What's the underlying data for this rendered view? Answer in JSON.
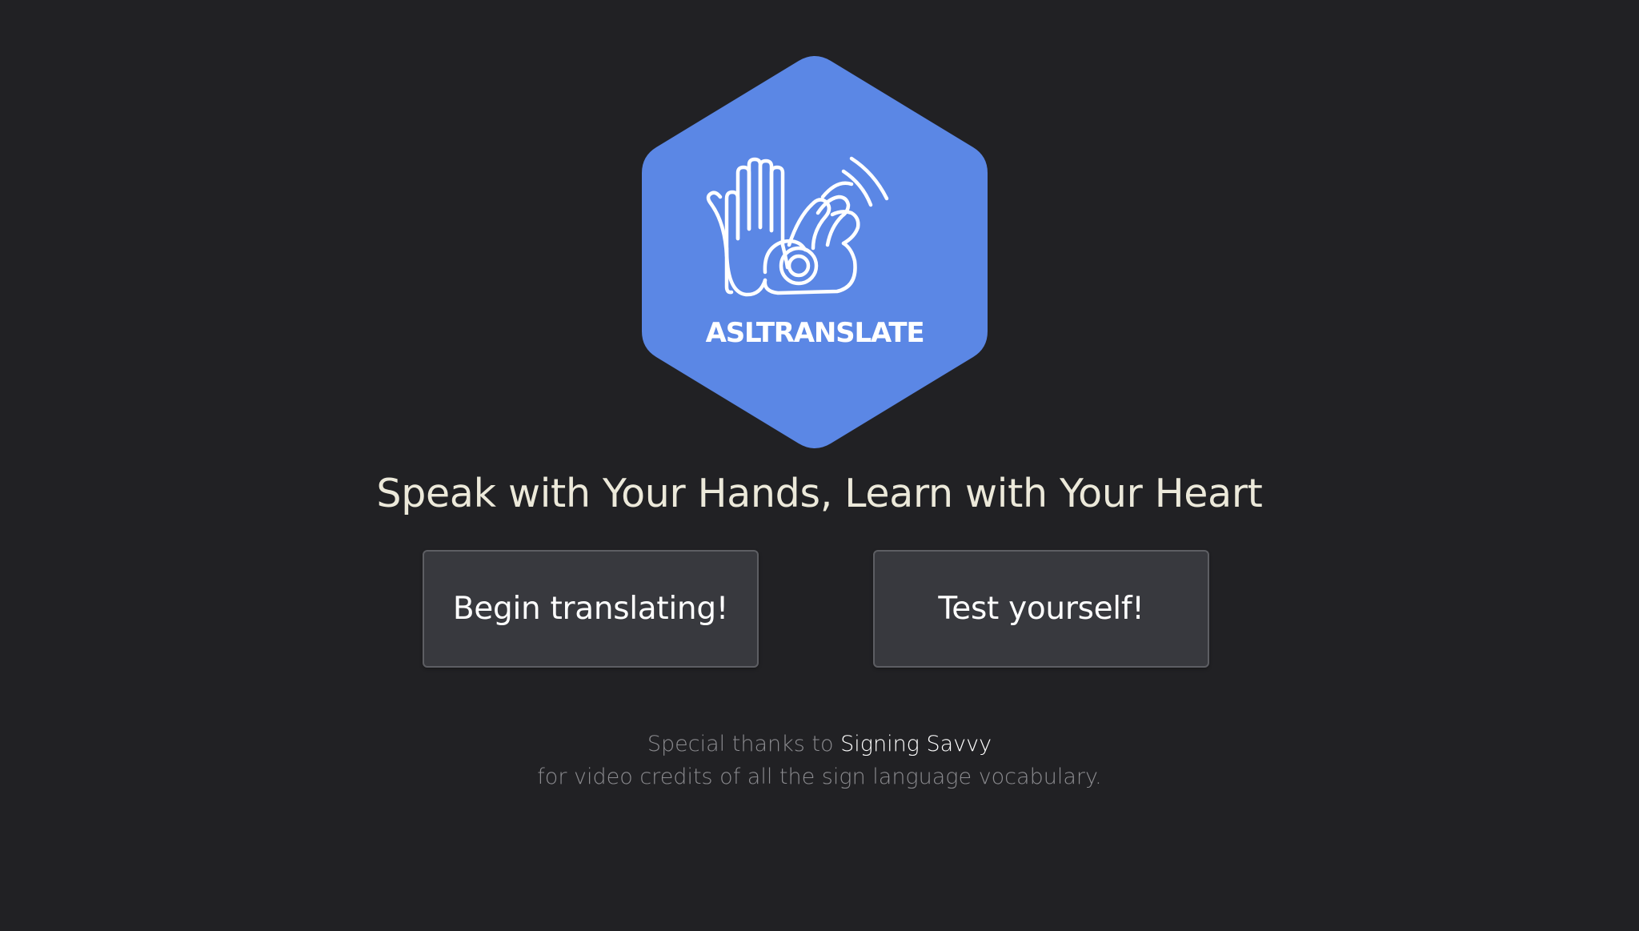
{
  "logo": {
    "wordmark": "ASLTRANSLATE",
    "icon": "signing-hands-icon",
    "color": "#5b87e5"
  },
  "tagline": "Speak with Your Hands, Learn with Your Heart",
  "buttons": {
    "translate_label": "Begin translating!",
    "test_label": "Test yourself!"
  },
  "credits": {
    "prefix": "Special thanks to ",
    "link_text": "Signing Savvy",
    "line2": "for video credits of all the sign language vocabulary."
  },
  "colors": {
    "background": "#212124",
    "button_bg": "#38393e",
    "tagline": "#ece9da",
    "muted_text": "#8b8b8f"
  }
}
